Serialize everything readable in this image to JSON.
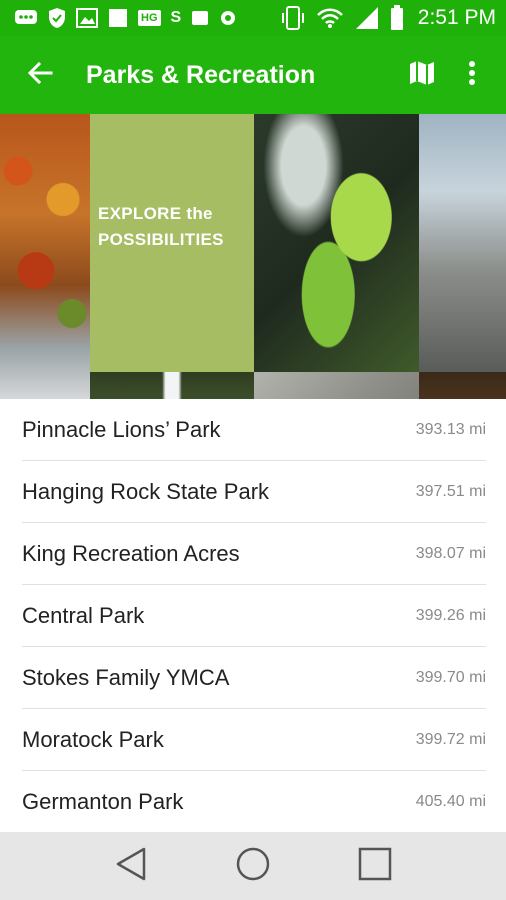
{
  "status_bar": {
    "time": "2:51 PM",
    "icons": [
      "message-icon",
      "shield-icon",
      "image-icon",
      "square-icon",
      "hg-icon",
      "s-icon",
      "square-icon",
      "camera-icon",
      "vibrate-icon",
      "wifi-icon",
      "signal-icon",
      "battery-icon"
    ],
    "hg_label": "HG",
    "s_label": "S"
  },
  "app_bar": {
    "title": "Parks & Recreation",
    "back_icon": "arrow-back-icon",
    "map_icon": "map-icon",
    "more_icon": "more-vert-icon",
    "color": "#22b50d"
  },
  "banner": {
    "line1": "EXPLORE the",
    "line2": "POSSIBILITIES"
  },
  "parks": [
    {
      "name": "Pinnacle Lions’ Park",
      "distance": "393.13 mi"
    },
    {
      "name": "Hanging Rock State Park",
      "distance": "397.51 mi"
    },
    {
      "name": "King Recreation Acres",
      "distance": "398.07 mi"
    },
    {
      "name": "Central Park",
      "distance": "399.26 mi"
    },
    {
      "name": "Stokes Family YMCA",
      "distance": "399.70 mi"
    },
    {
      "name": "Moratock Park",
      "distance": "399.72 mi"
    },
    {
      "name": "Germanton Park",
      "distance": "405.40 mi"
    }
  ],
  "nav_bar": {
    "buttons": [
      "back-triangle-icon",
      "home-circle-icon",
      "recents-square-icon"
    ]
  }
}
